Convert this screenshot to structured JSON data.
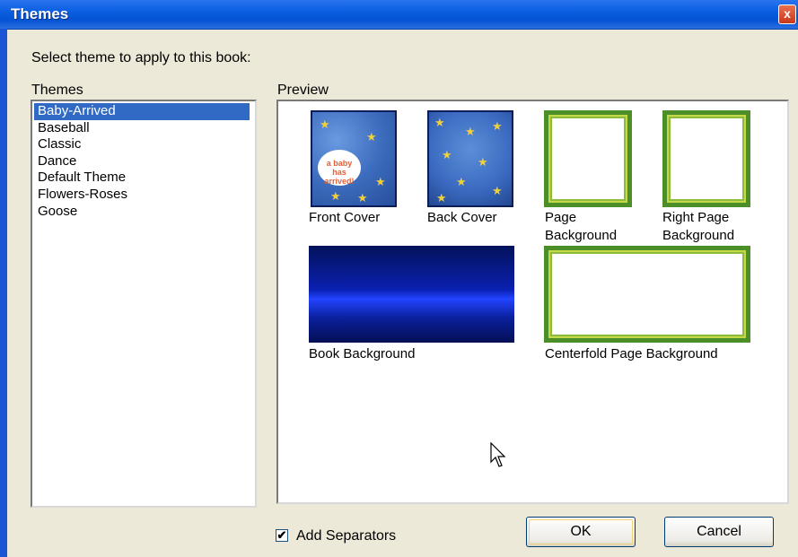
{
  "window": {
    "title": "Themes",
    "close_label": "x"
  },
  "instruction": "Select theme to apply to this book:",
  "themes_list": {
    "label": "Themes",
    "items": [
      "Baby-Arrived",
      "Baseball",
      "Classic",
      "Dance",
      "Default Theme",
      "Flowers-Roses",
      "Goose"
    ],
    "selected": "Baby-Arrived"
  },
  "preview": {
    "label": "Preview",
    "front_cover": "Front Cover",
    "back_cover": "Back Cover",
    "page_background_line1": "Page",
    "page_background_line2": "Background",
    "right_page_background_line1": "Right Page",
    "right_page_background_line2": "Background",
    "book_background": "Book Background",
    "centerfold_page_background": "Centerfold Page Background",
    "cover_text_line1": "a baby",
    "cover_text_line2": "has arrived!"
  },
  "add_separators": {
    "label": "Add Separators",
    "checked": true,
    "check_glyph": "✔"
  },
  "buttons": {
    "ok": "OK",
    "cancel": "Cancel"
  },
  "colors": {
    "titlebar": "#0453d4",
    "selection": "#316ac5",
    "dialog_bg": "#ece9d8"
  },
  "icons": [
    "close-icon",
    "mouse-pointer-icon",
    "checkmark-icon"
  ]
}
